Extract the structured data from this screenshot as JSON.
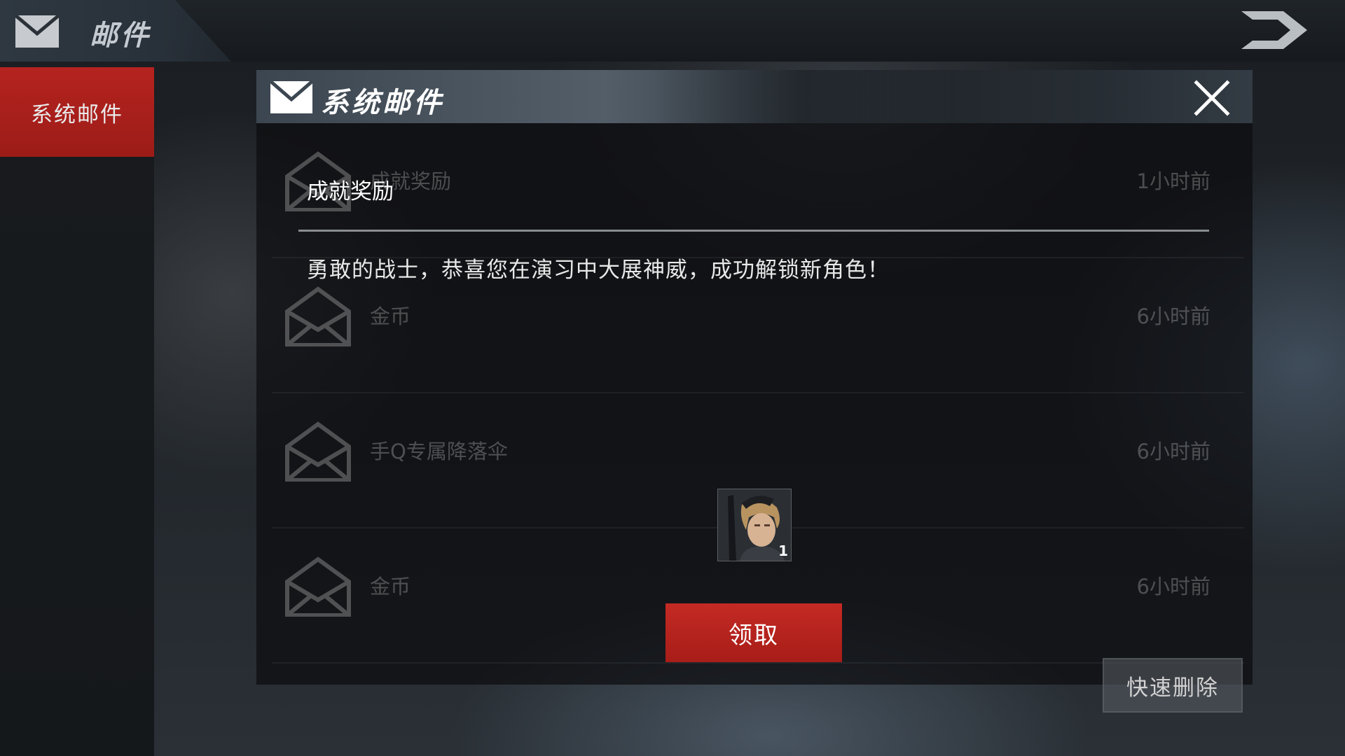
{
  "header": {
    "title": "邮件",
    "icon": "mail-icon",
    "back_icon": "back-arrow-icon"
  },
  "sidebar": {
    "items": [
      {
        "label": "系统邮件",
        "selected": true
      }
    ]
  },
  "panel": {
    "title": "系统邮件",
    "icon": "mail-icon",
    "close_icon": "close-icon"
  },
  "mail_list": [
    {
      "title": "成就奖励",
      "time": "1小时前"
    },
    {
      "title": "金币",
      "time": "6小时前"
    },
    {
      "title": "手Q专属降落伞",
      "time": "6小时前"
    },
    {
      "title": "金币",
      "time": "6小时前"
    }
  ],
  "detail": {
    "title": "成就奖励",
    "body": "勇敢的战士，恭喜您在演习中大展神威，成功解锁新角色！",
    "reward": {
      "name": "character-portrait",
      "count": "1"
    },
    "claim_label": "领取"
  },
  "quick_delete_label": "快速删除",
  "colors": {
    "accent_red": "#b5231f",
    "panel_bg": "#0c0d0f",
    "text_white": "#ffffff"
  }
}
